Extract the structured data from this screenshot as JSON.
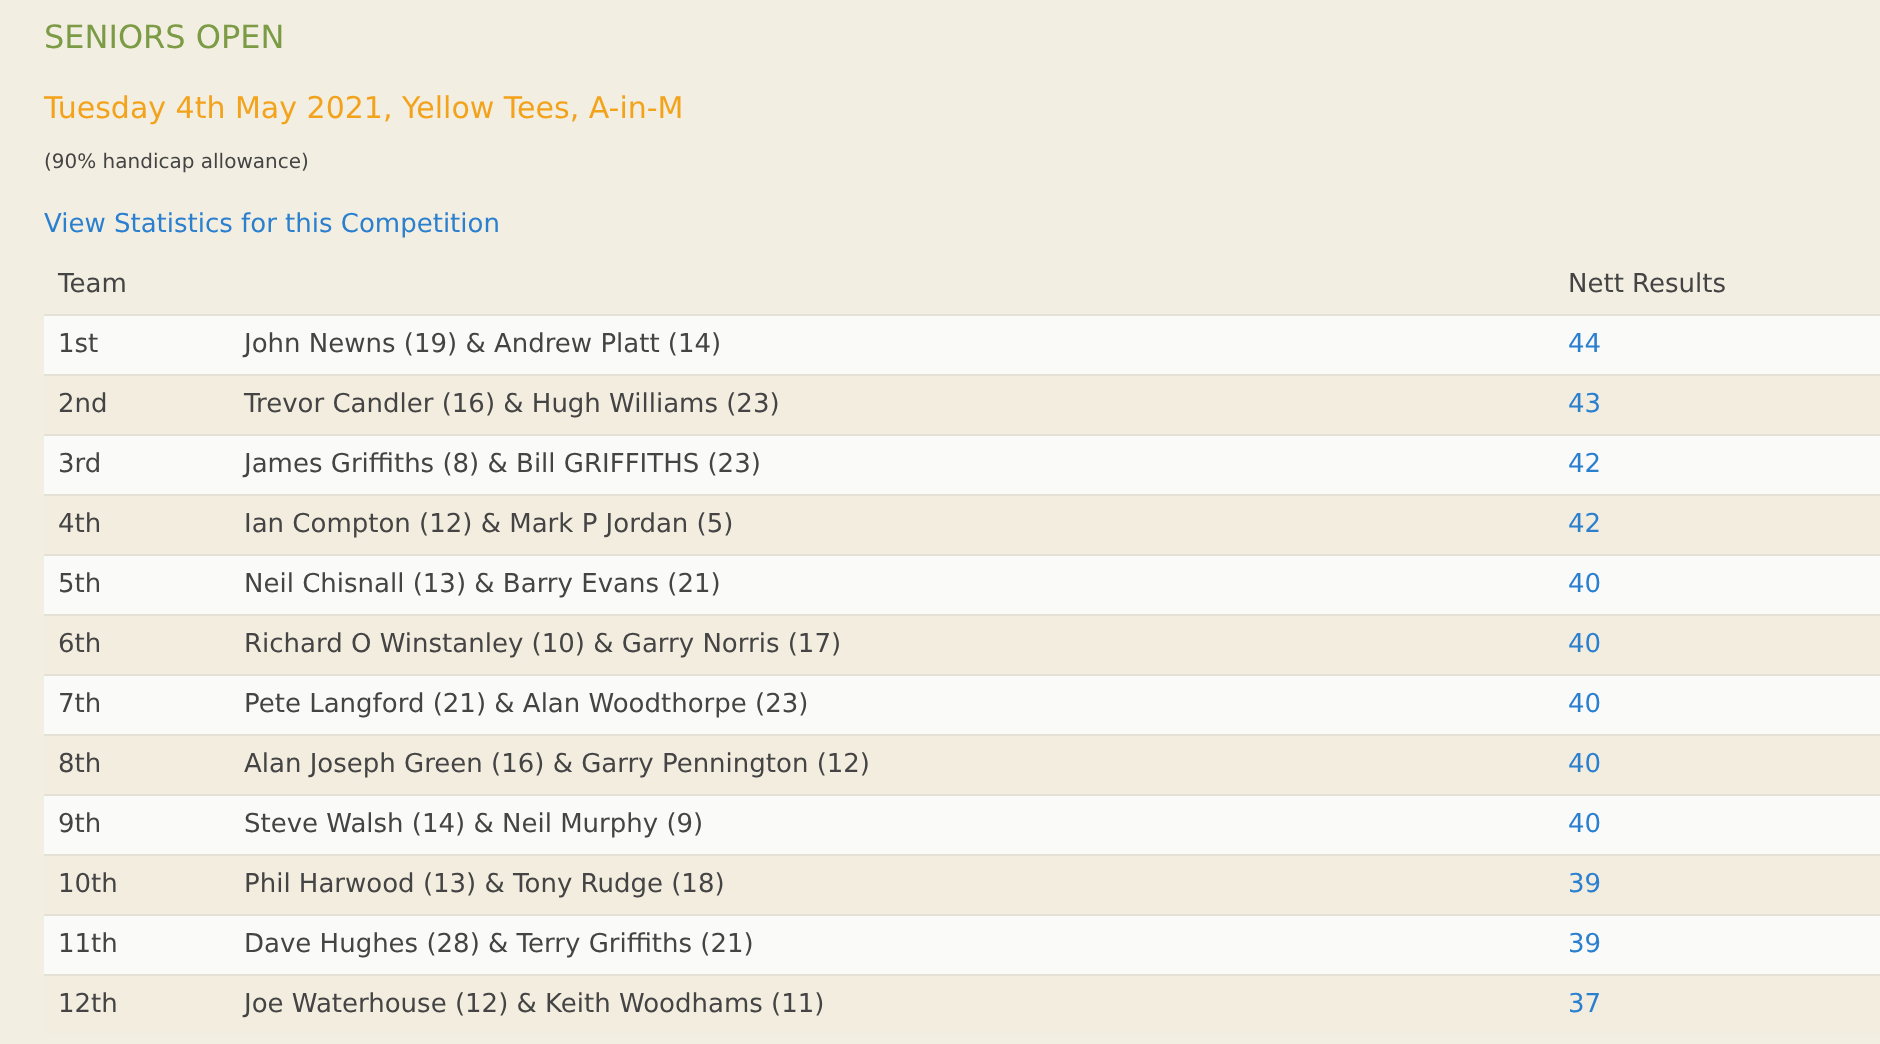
{
  "title": "SENIORS OPEN",
  "subtitle": "Tuesday 4th May 2021, Yellow Tees, A-in-M",
  "note": "(90% handicap allowance)",
  "stats_link": "View Statistics for this Competition",
  "table": {
    "columns": [
      "Team",
      "Nett Results"
    ],
    "rows": [
      {
        "position": "1st",
        "team": "John Newns (19) & Andrew Platt (14)",
        "result": "44"
      },
      {
        "position": "2nd",
        "team": "Trevor Candler (16) & Hugh Williams (23)",
        "result": "43"
      },
      {
        "position": "3rd",
        "team": "James Griffiths (8) & Bill GRIFFITHS (23)",
        "result": "42"
      },
      {
        "position": "4th",
        "team": "Ian Compton (12) & Mark P Jordan (5)",
        "result": "42"
      },
      {
        "position": "5th",
        "team": "Neil Chisnall (13) & Barry Evans (21)",
        "result": "40"
      },
      {
        "position": "6th",
        "team": "Richard O Winstanley (10) & Garry Norris (17)",
        "result": "40"
      },
      {
        "position": "7th",
        "team": "Pete Langford (21) & Alan Woodthorpe (23)",
        "result": "40"
      },
      {
        "position": "8th",
        "team": "Alan Joseph Green (16) & Garry Pennington (12)",
        "result": "40"
      },
      {
        "position": "9th",
        "team": "Steve Walsh (14) & Neil Murphy (9)",
        "result": "40"
      },
      {
        "position": "10th",
        "team": "Phil Harwood (13) & Tony Rudge (18)",
        "result": "39"
      },
      {
        "position": "11th",
        "team": "Dave Hughes (28) & Terry Griffiths (21)",
        "result": "39"
      },
      {
        "position": "12th",
        "team": "Joe Waterhouse (12) & Keith Woodhams (11)",
        "result": "37"
      }
    ]
  }
}
